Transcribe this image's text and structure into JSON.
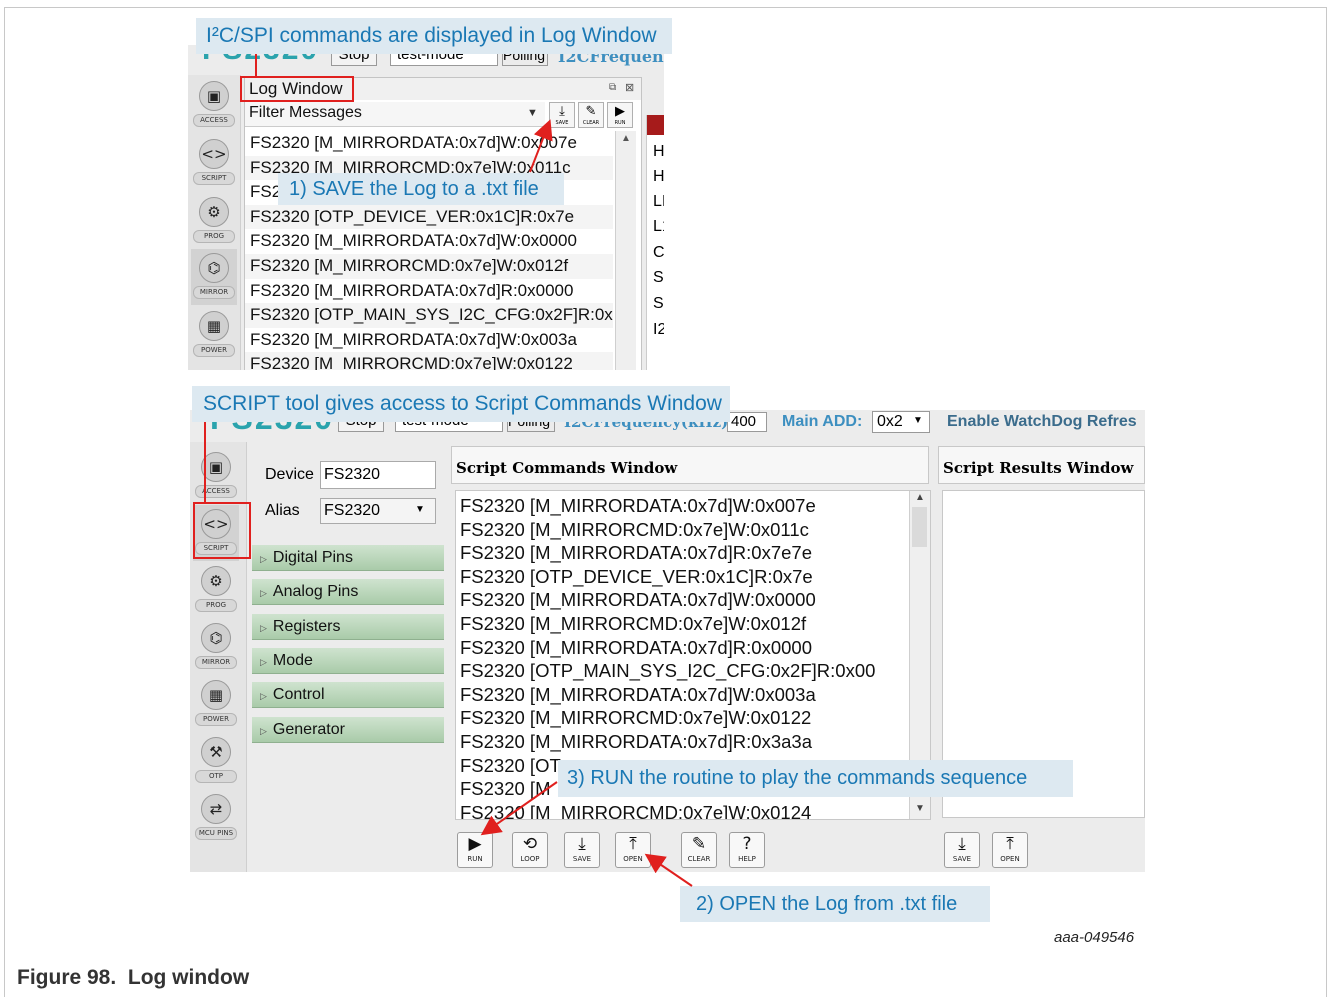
{
  "figure": {
    "id_code": "aaa-049546",
    "caption": "Figure 98.  Log window"
  },
  "callouts": {
    "top": "I²C/SPI commands are displayed in Log Window",
    "save": "1) SAVE the Log to a .txt file",
    "script_tool": "SCRIPT tool gives access to Script Commands Window",
    "run": "3) RUN the routine to play the commands sequence",
    "open": "2) OPEN the Log from .txt file"
  },
  "top_header": {
    "device_partial": "FS2320",
    "stop": "Stop",
    "mode": "test-mode",
    "polling": "Polling",
    "freq": "I2CFrequency"
  },
  "sidebar": {
    "access": "ACCESS",
    "script": "SCRIPT",
    "prog": "PROG",
    "mirror": "MIRROR",
    "power": "POWER",
    "otp": "OTP",
    "mcu_pins": "MCU PINS"
  },
  "icons": {
    "access": "chip-icon",
    "script": "code-brackets-icon",
    "prog": "gear-chip-icon",
    "mirror": "mirror-icon",
    "power": "calculator-icon",
    "otp": "hammer-icon",
    "mcu_pins": "pins-icon"
  },
  "log_window": {
    "title": "Log Window",
    "filter": "Filter Messages",
    "save": "SAVE",
    "clear": "CLEAR",
    "run": "RUN",
    "lines": [
      "FS2320 [M_MIRRORDATA:0x7d]W:0x007e",
      "FS2320 [M_MIRRORCMD:0x7e]W:0x011c",
      "FS2",
      "FS2320 [OTP_DEVICE_VER:0x1C]R:0x7e",
      "FS2320 [M_MIRRORDATA:0x7d]W:0x0000",
      "FS2320 [M_MIRRORCMD:0x7e]W:0x012f",
      "FS2320 [M_MIRRORDATA:0x7d]R:0x0000",
      "FS2320 [OTP_MAIN_SYS_I2C_CFG:0x2F]R:0x00",
      "FS2320 [M_MIRRORDATA:0x7d]W:0x003a",
      "FS2320 [M_MIRRORCMD:0x7e]W:0x0122"
    ],
    "side_letters": [
      "H",
      "H",
      "LI",
      "L1",
      "C",
      "S",
      "S",
      "I2"
    ]
  },
  "bottom_header": {
    "device_partial": "FS2320",
    "stop": "Stop",
    "mode": "test-mode",
    "polling": "Polling",
    "freq_label": "I2CFrequency(kHz):",
    "freq_value": "400",
    "main_add_label": "Main ADD:",
    "main_add_value": "0x2",
    "watchdog": "Enable WatchDog Refres"
  },
  "device_panel": {
    "device_label": "Device",
    "device_value": "FS2320",
    "alias_label": "Alias",
    "alias_value": "FS2320",
    "sections": [
      "Digital Pins",
      "Analog Pins",
      "Registers",
      "Mode",
      "Control",
      "Generator"
    ]
  },
  "script_window": {
    "title": "Script Commands Window",
    "lines": [
      "FS2320 [M_MIRRORDATA:0x7d]W:0x007e",
      "FS2320 [M_MIRRORCMD:0x7e]W:0x011c",
      "FS2320 [M_MIRRORDATA:0x7d]R:0x7e7e",
      "FS2320 [OTP_DEVICE_VER:0x1C]R:0x7e",
      "FS2320 [M_MIRRORDATA:0x7d]W:0x0000",
      "FS2320 [M_MIRRORCMD:0x7e]W:0x012f",
      "FS2320 [M_MIRRORDATA:0x7d]R:0x0000",
      "FS2320 [OTP_MAIN_SYS_I2C_CFG:0x2F]R:0x00",
      "FS2320 [M_MIRRORDATA:0x7d]W:0x003a",
      "FS2320 [M_MIRRORCMD:0x7e]W:0x0122",
      "FS2320 [M_MIRRORDATA:0x7d]R:0x3a3a",
      "FS2320 [OT",
      "FS2320 [M",
      "FS2320 [M_MIRRORCMD:0x7e]W:0x0124"
    ],
    "buttons": {
      "run": "RUN",
      "loop": "LOOP",
      "save": "SAVE",
      "open": "OPEN",
      "clear": "CLEAR",
      "help": "HELP"
    }
  },
  "results_window": {
    "title": "Script Results Window",
    "save": "SAVE",
    "open": "OPEN"
  }
}
